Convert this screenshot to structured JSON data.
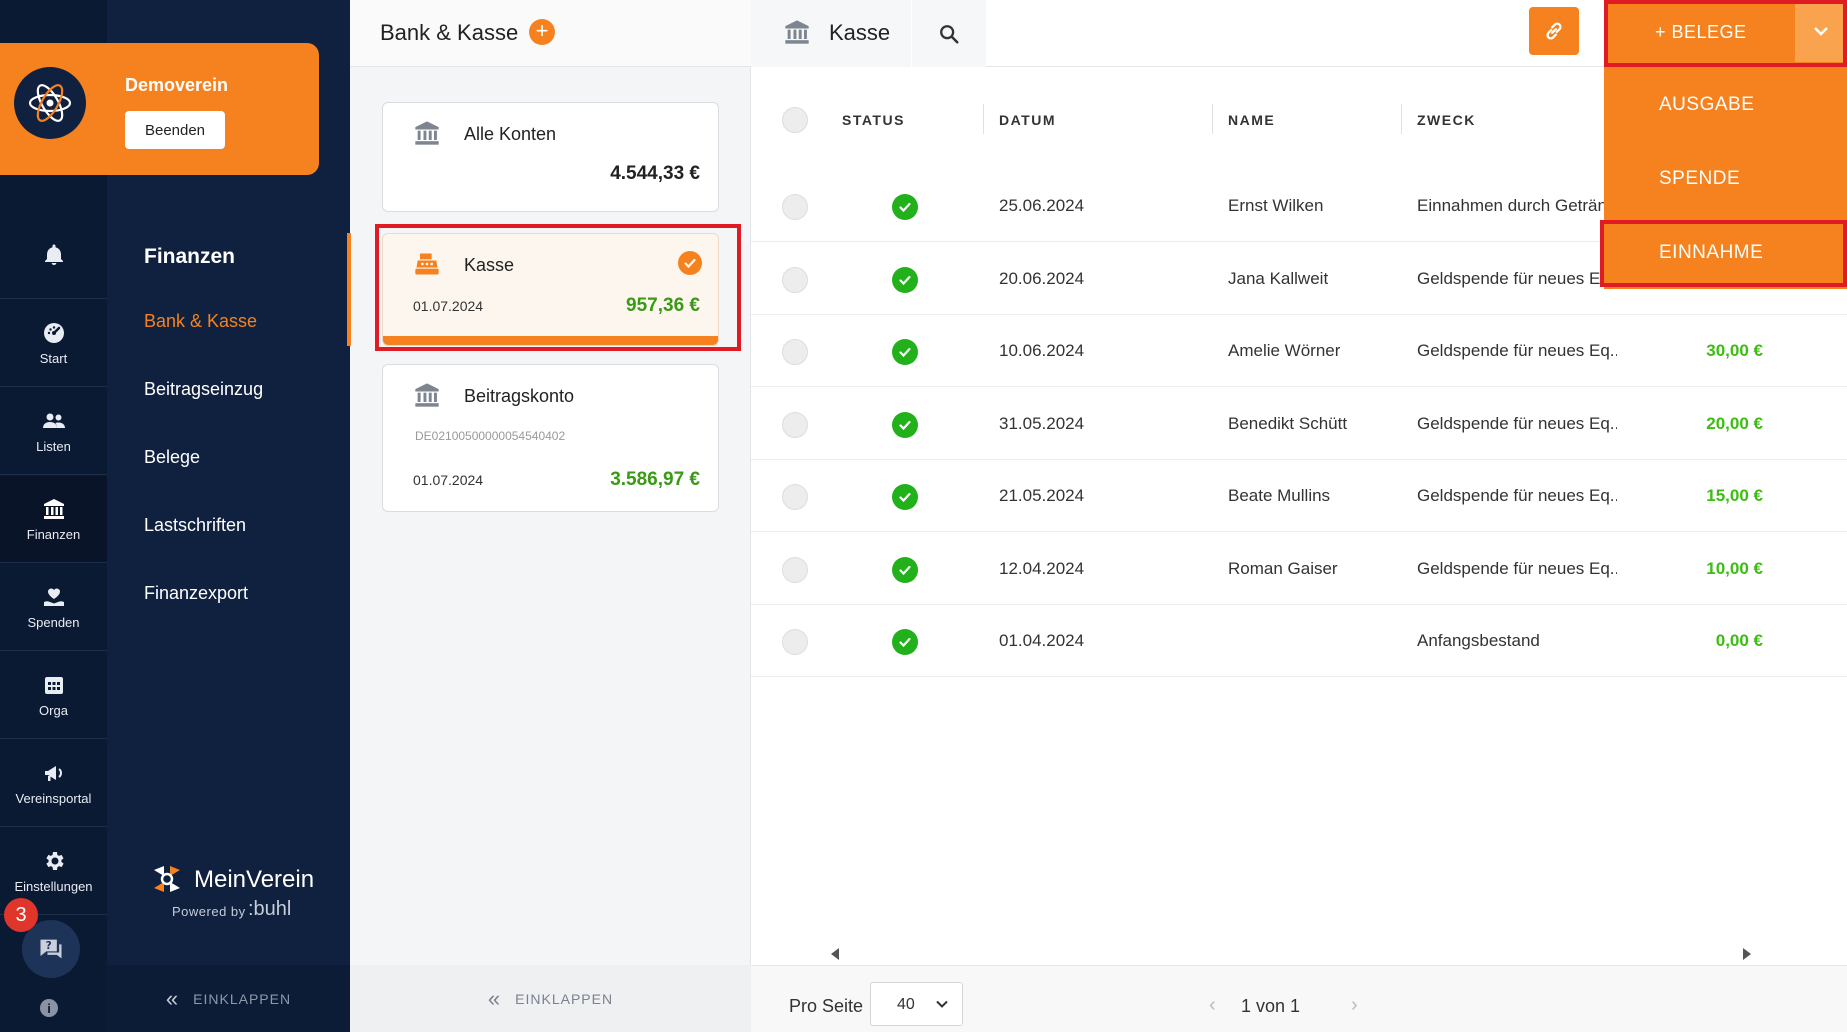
{
  "org": {
    "name": "Demoverein",
    "end_label": "Beenden"
  },
  "rail": {
    "items": [
      {
        "label": ""
      },
      {
        "label": "Start"
      },
      {
        "label": "Listen"
      },
      {
        "label": "Finanzen"
      },
      {
        "label": "Spenden"
      },
      {
        "label": "Orga"
      },
      {
        "label": "Vereinsportal"
      },
      {
        "label": "Einstellungen"
      }
    ],
    "chat_badge": "3",
    "info": "i"
  },
  "nav": {
    "heading": "Finanzen",
    "items": [
      "Bank & Kasse",
      "Beitragseinzug",
      "Belege",
      "Lastschriften",
      "Finanzexport"
    ],
    "collapse": "EINKLAPPEN"
  },
  "brand": {
    "name": "MeinVerein",
    "powered": "Powered by",
    "buhl": ":buhl"
  },
  "accounts": {
    "title": "Bank & Kasse",
    "add": "+",
    "cards": [
      {
        "name": "Alle Konten",
        "amount": "4.544,33 €"
      },
      {
        "name": "Kasse",
        "date": "01.07.2024",
        "amount": "957,36 €"
      },
      {
        "name": "Beitragskonto",
        "iban": "DE02100500000054540402",
        "date": "01.07.2024",
        "amount": "3.586,97 €"
      }
    ],
    "collapse": "EINKLAPPEN"
  },
  "main": {
    "title": "Kasse",
    "columns": [
      "STATUS",
      "DATUM",
      "NAME",
      "ZWECK"
    ],
    "rows": [
      {
        "date": "25.06.2024",
        "name": "Ernst Wilken",
        "purpose": "Einnahmen durch Geträn",
        "amount": ""
      },
      {
        "date": "20.06.2024",
        "name": "Jana Kallweit",
        "purpose": "Geldspende für neues Eq",
        "amount": ""
      },
      {
        "date": "10.06.2024",
        "name": "Amelie Wörner",
        "purpose": "Geldspende für neues Eq...",
        "amount": "30,00 €"
      },
      {
        "date": "31.05.2024",
        "name": "Benedikt Schütt",
        "purpose": "Geldspende für neues Eq...",
        "amount": "20,00 €"
      },
      {
        "date": "21.05.2024",
        "name": "Beate Mullins",
        "purpose": "Geldspende für neues Eq...",
        "amount": "15,00 €"
      },
      {
        "date": "12.04.2024",
        "name": "Roman Gaiser",
        "purpose": "Geldspende für neues Eq...",
        "amount": "10,00 €"
      },
      {
        "date": "01.04.2024",
        "name": "",
        "purpose": "Anfangsbestand",
        "amount": "0,00 €"
      }
    ],
    "per_page_label": "Pro Seite",
    "per_page_value": "40",
    "page_info": "1 von 1"
  },
  "belege": {
    "label": "+ BELEGE",
    "menu": [
      "AUSGABE",
      "SPENDE",
      "EINNAHME"
    ]
  },
  "colors": {
    "orange": "#f5821f",
    "navy": "#0f213f",
    "green": "#22b11a",
    "highlight": "#e01b24"
  }
}
